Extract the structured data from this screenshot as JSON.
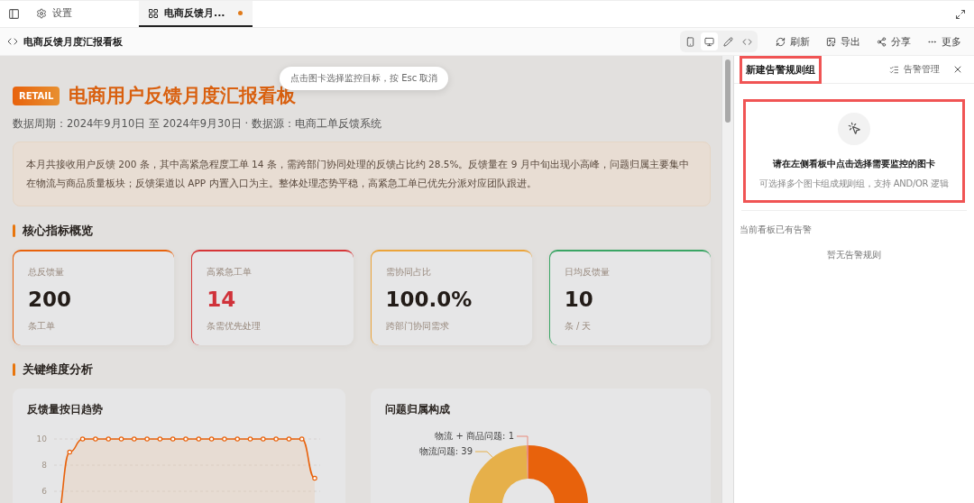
{
  "tabs": [
    {
      "label": "设置",
      "kind": "settings",
      "selected": false,
      "unsaved": false
    },
    {
      "label": "电商反馈月...",
      "kind": "dashboard",
      "selected": true,
      "unsaved": true
    }
  ],
  "toolbar": {
    "title": "电商反馈月度汇报看板",
    "view_modes": [
      {
        "kind": "mobile",
        "selected": false
      },
      {
        "kind": "desktop",
        "selected": true
      },
      {
        "kind": "edit",
        "selected": false
      },
      {
        "kind": "code",
        "selected": false
      }
    ],
    "actions": [
      {
        "kind": "refresh",
        "label": "刷新"
      },
      {
        "kind": "export",
        "label": "导出"
      },
      {
        "kind": "share",
        "label": "分享"
      },
      {
        "kind": "more",
        "label": "更多"
      }
    ]
  },
  "hint": "点击图卡选择监控目标，按 Esc 取消",
  "dashboard": {
    "badge": "RETAIL",
    "title": "电商用户反馈月度汇报看板",
    "meta": "数据周期：2024年9月10日 至 2024年9月30日 · 数据源：电商工单反馈系统",
    "summary": "本月共接收用户反馈 200 条，其中高紧急程度工单 14 条，需跨部门协同处理的反馈占比约 28.5%。反馈量在 9 月中旬出现小高峰，问题归属主要集中在物流与商品质量板块；反馈渠道以 APP 内置入口为主。整体处理态势平稳，高紧急工单已优先分派对应团队跟进。",
    "kpi_section": "核心指标概览",
    "kpis": [
      {
        "label": "总反馈量",
        "value": "200",
        "note": "条工单",
        "color": "#e8620c",
        "alert": false
      },
      {
        "label": "高紧急工单",
        "value": "14",
        "note": "条需优先处理",
        "color": "#d63638",
        "alert": true
      },
      {
        "label": "需协同占比",
        "value": "100.0%",
        "note": "跨部门协同需求",
        "color": "#eba43a",
        "alert": false
      },
      {
        "label": "日均反馈量",
        "value": "10",
        "note": "条 / 天",
        "color": "#3aa565",
        "alert": false
      }
    ],
    "analysis_section": "关键维度分析",
    "charts": [
      {
        "kind": "line",
        "title": "反馈量按日趋势",
        "chart_data": {
          "type": "line",
          "ylim": [
            4,
            10
          ],
          "yticks": [
            6,
            8,
            10
          ],
          "series": [
            {
              "color": "#e8620c",
              "marker": true,
              "values": [
                4,
                9,
                10,
                10,
                10,
                10,
                10,
                10,
                10,
                10,
                10,
                10,
                10,
                10,
                10,
                10,
                10,
                10,
                10,
                10,
                7
              ]
            }
          ]
        }
      },
      {
        "kind": "donut",
        "title": "问题归属构成",
        "slice_labels": [
          "物流 + 商品问题: 1",
          "物流问题: 39"
        ]
      }
    ]
  },
  "panel": {
    "title": "新建告警规则组",
    "title_highlighted": true,
    "manage": "告警管理",
    "empty_title": "请在左侧看板中点击选择需要监控的图卡",
    "empty_hint": "可选择多个图卡组成规则组，支持 AND/OR 逻辑",
    "empty_highlighted": true,
    "existing_label": "当前看板已有告警",
    "existing_empty": "暂无告警规则"
  }
}
